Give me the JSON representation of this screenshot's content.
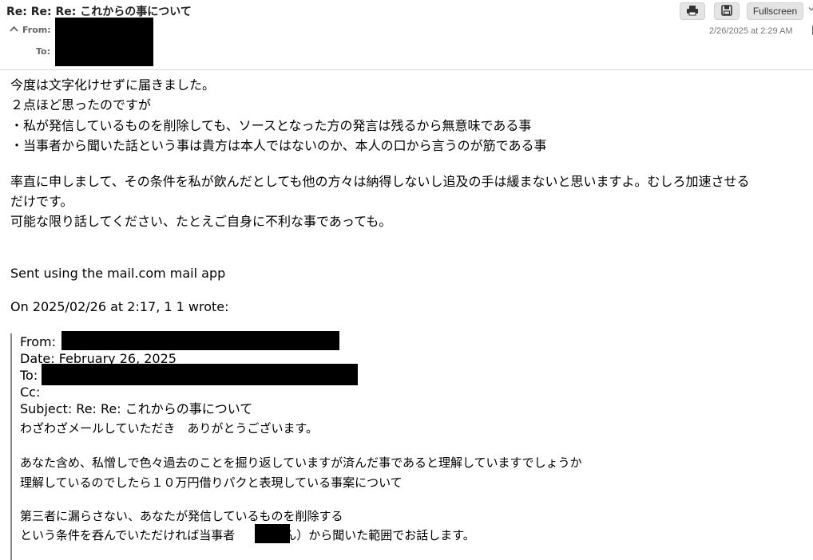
{
  "header": {
    "subject": "Re: Re: Re: これからの事について",
    "from_label": "From:",
    "to_label": "To:",
    "date": "2/26/2025 at 2:29 AM",
    "toolbar": {
      "print_icon": "printer-icon",
      "save_icon": "floppy-disk-icon",
      "fullscreen_label": "Fullscreen",
      "more_icon": "chevron-down-icon"
    },
    "toggle_icon": "chevron-up-icon"
  },
  "body": {
    "lines": [
      "今度は文字化けせずに届きました。",
      "２点ほど思ったのですが",
      "・私が発信しているものを削除しても、ソースとなった方の発言は残るから無意味である事",
      "・当事者から聞いた話という事は貴方は本人ではないのか、本人の口から言うのが筋である事",
      "率直に申しまして、その条件を私が飲んだとしても他の方々は納得しないし追及の手は緩まないと思いますよ。むしろ加速させる",
      "だけです。",
      "可能な限り話してください、たとえご自身に不利な事であっても。"
    ],
    "signature": "Sent using the mail.com mail app",
    "wrote_line": "On 2025/02/26 at 2:17, 1 1 wrote:"
  },
  "quoted": {
    "from_label": "From:",
    "date_line": "Date: February 26, 2025",
    "to_label": "To:",
    "cc_label": "Cc:",
    "subject_line": "Subject: Re: Re: これからの事について",
    "lines": [
      "わざわざメールしていただき　ありがとうございます。",
      "あなた含め、私憎しで色々過去のことを掘り返していますが済んだ事であると理解していますでしょうか",
      "理解しているのでしたら１０万円借りパクと表現している事案について",
      "第三者に漏らさない、あなたが発信しているものを削除する",
      "という条件を呑んでいただければ当事者"
    ],
    "last_line_suffix": "さん）から聞いた範囲でお話します。"
  }
}
